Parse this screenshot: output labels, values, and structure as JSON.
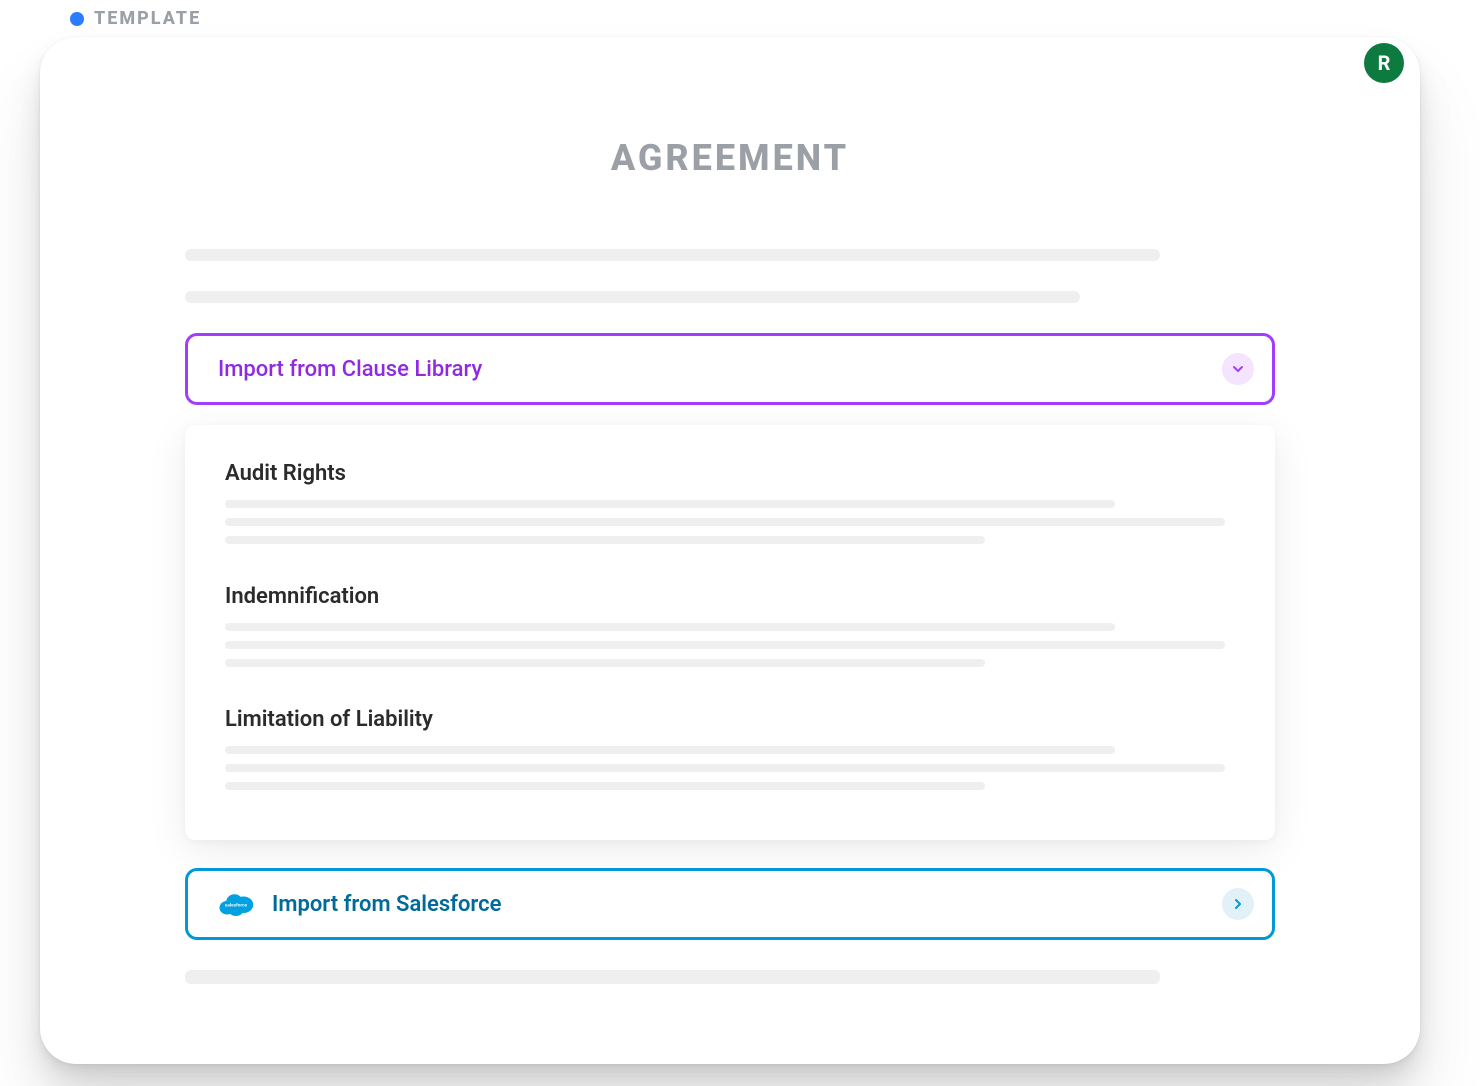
{
  "header": {
    "tag": "TEMPLATE",
    "avatar_initial": "R"
  },
  "document": {
    "title": "AGREEMENT"
  },
  "fields": {
    "clause_library": {
      "label": "Import from Clause Library"
    },
    "salesforce": {
      "label": "Import from Salesforce"
    }
  },
  "clause_options": [
    {
      "title": "Audit Rights"
    },
    {
      "title": "Indemnification"
    },
    {
      "title": "Limitation of Liability"
    }
  ]
}
